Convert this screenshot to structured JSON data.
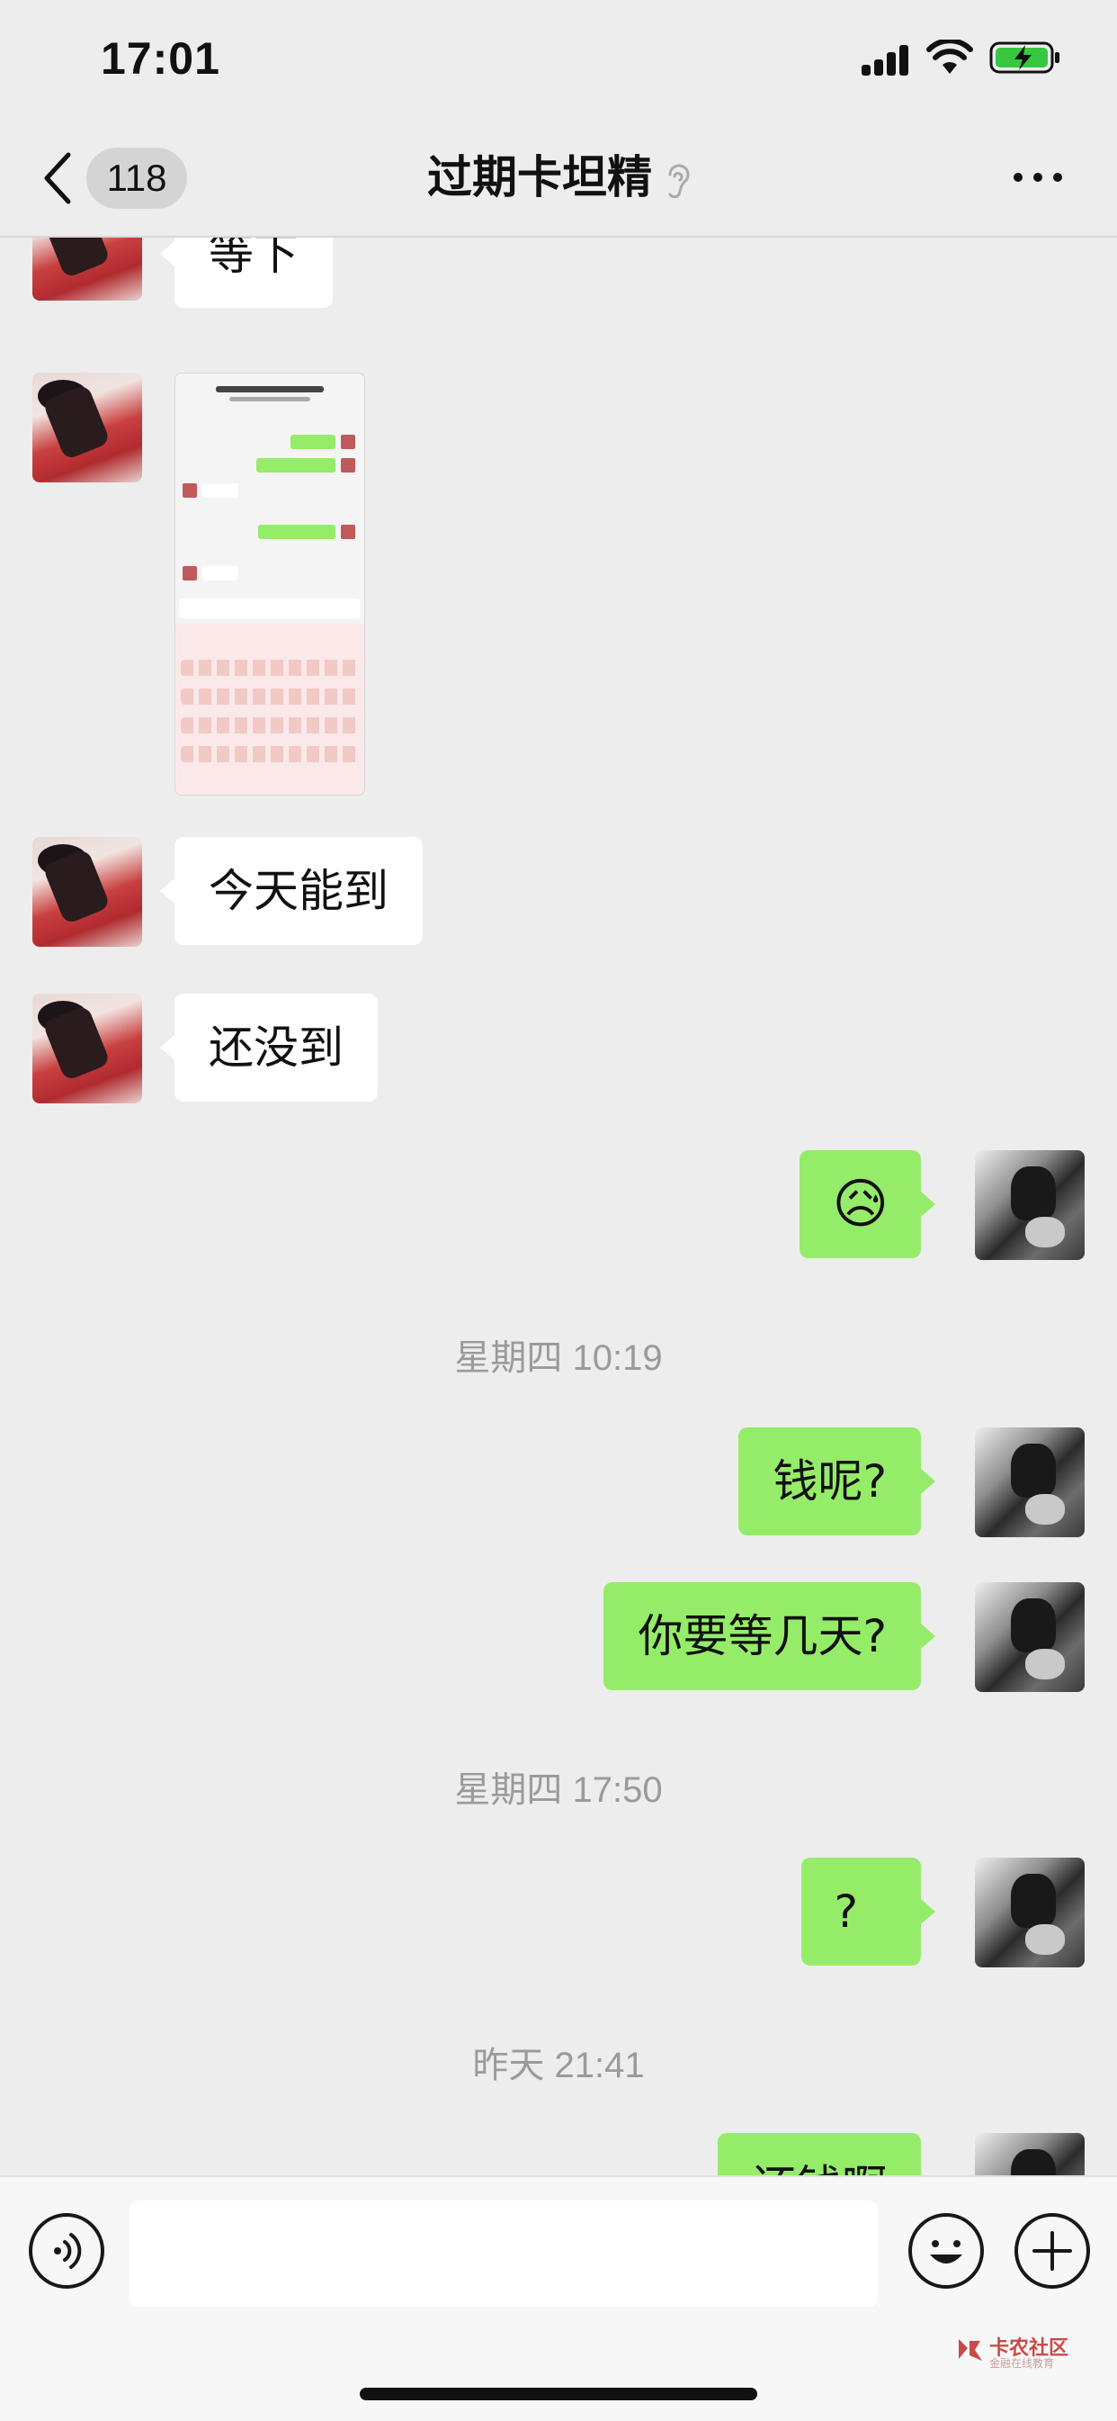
{
  "status_bar": {
    "time": "17:01"
  },
  "nav": {
    "back_badge": "118",
    "title": "过期卡坦精"
  },
  "messages": [
    {
      "text": "等下"
    },
    {
      "text": "今天能到"
    },
    {
      "text": "还没到"
    },
    {
      "text": "😥"
    },
    {
      "text": "钱呢?"
    },
    {
      "text": "你要等几天?"
    },
    {
      "text": "?"
    },
    {
      "text": "还钱啊"
    }
  ],
  "timestamps": [
    "星期四 10:19",
    "星期四 17:50",
    "昨天 21:41"
  ],
  "watermark": {
    "title": "卡农社区",
    "subtitle": "金融在线教育"
  },
  "colors": {
    "background": "#ededed",
    "outgoing_bubble": "#95ec69",
    "incoming_bubble": "#ffffff"
  }
}
